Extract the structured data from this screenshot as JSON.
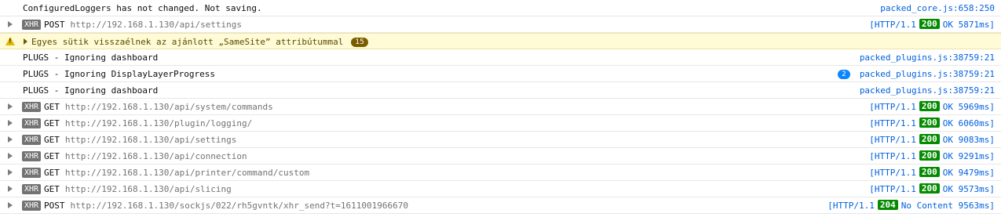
{
  "rows": [
    {
      "type": "log",
      "text": "ConfiguredLoggers has not changed. Not saving.",
      "source": "packed_core.js:658:250"
    },
    {
      "type": "xhr",
      "method": "POST",
      "url": "http://192.168.1.130/api/settings",
      "proto": "[HTTP/1.1",
      "code": "200",
      "status": "OK 5871ms]"
    },
    {
      "type": "warning",
      "text": "Egyes sütik visszaélnek az ajánlott „SameSite” attribútummal",
      "count": "15"
    },
    {
      "type": "log",
      "text": "PLUGS - Ignoring dashboard",
      "source": "packed_plugins.js:38759:21"
    },
    {
      "type": "log",
      "text": "PLUGS - Ignoring DisplayLayerProgress",
      "repeat": "2",
      "source": "packed_plugins.js:38759:21"
    },
    {
      "type": "log",
      "text": "PLUGS - Ignoring dashboard",
      "source": "packed_plugins.js:38759:21"
    },
    {
      "type": "xhr",
      "method": "GET",
      "url": "http://192.168.1.130/api/system/commands",
      "proto": "[HTTP/1.1",
      "code": "200",
      "status": "OK 5969ms]"
    },
    {
      "type": "xhr",
      "method": "GET",
      "url": "http://192.168.1.130/plugin/logging/",
      "proto": "[HTTP/1.1",
      "code": "200",
      "status": "OK 6060ms]"
    },
    {
      "type": "xhr",
      "method": "GET",
      "url": "http://192.168.1.130/api/settings",
      "proto": "[HTTP/1.1",
      "code": "200",
      "status": "OK 9083ms]"
    },
    {
      "type": "xhr",
      "method": "GET",
      "url": "http://192.168.1.130/api/connection",
      "proto": "[HTTP/1.1",
      "code": "200",
      "status": "OK 9291ms]"
    },
    {
      "type": "xhr",
      "method": "GET",
      "url": "http://192.168.1.130/api/printer/command/custom",
      "proto": "[HTTP/1.1",
      "code": "200",
      "status": "OK 9479ms]"
    },
    {
      "type": "xhr",
      "method": "GET",
      "url": "http://192.168.1.130/api/slicing",
      "proto": "[HTTP/1.1",
      "code": "200",
      "status": "OK 9573ms]"
    },
    {
      "type": "xhr",
      "method": "POST",
      "url": "http://192.168.1.130/sockjs/022/rh5gvntk/xhr_send?t=1611001966670",
      "proto": "[HTTP/1.1",
      "code": "204",
      "status": "No Content 9563ms]"
    }
  ],
  "labels": {
    "xhr": "XHR"
  },
  "colors": {
    "status_ok": "#058b00",
    "link": "#0060df",
    "warning_bg": "#fffbd6",
    "badge_gray": "#737373"
  },
  "icons": {
    "warning": "warning-triangle-icon",
    "expand": "expand-arrow-icon"
  }
}
